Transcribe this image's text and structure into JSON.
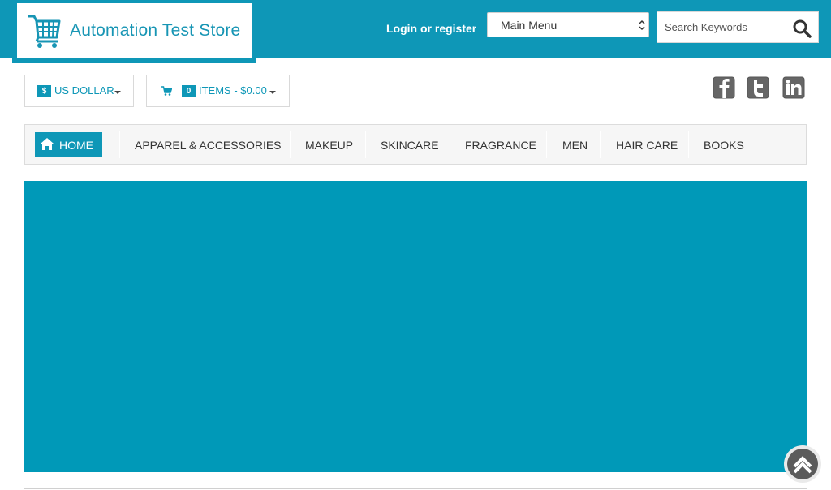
{
  "header": {
    "logo_text": "Automation Test Store",
    "login_text": "Login or register",
    "menu_select": {
      "selected": "Main Menu"
    },
    "search": {
      "placeholder": "Search Keywords"
    }
  },
  "toolbar": {
    "currency": {
      "symbol": "$",
      "label": "US DOLLAR"
    },
    "cart": {
      "count": "0",
      "label": "ITEMS - $0.00"
    }
  },
  "social": [
    "facebook",
    "twitter",
    "linkedin"
  ],
  "nav": {
    "home_label": "HOME",
    "items": [
      "APPAREL & ACCESSORIES",
      "MAKEUP",
      "SKINCARE",
      "FRAGRANCE",
      "MEN",
      "HAIR CARE",
      "BOOKS"
    ]
  },
  "colors": {
    "brand": "#0e97b7",
    "banner": "#0099b8"
  }
}
